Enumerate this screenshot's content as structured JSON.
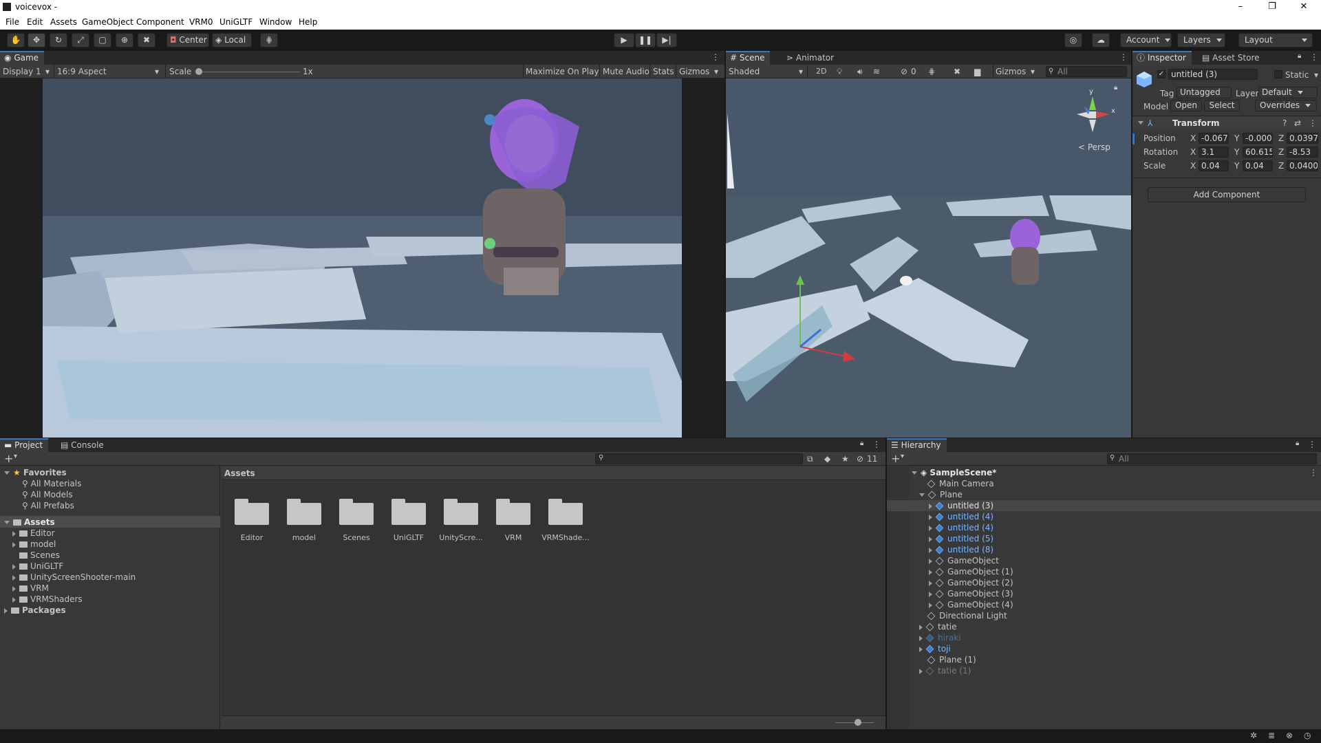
{
  "window": {
    "title": "voicevox -",
    "buttons": [
      "–",
      "❐",
      "✕"
    ]
  },
  "menu": [
    "File",
    "Edit",
    "Assets",
    "GameObject",
    "Component",
    "VRM0",
    "UniGLTF",
    "Window",
    "Help"
  ],
  "toolbar": {
    "pivot": "Center",
    "space": "Local",
    "account": "Account",
    "layers": "Layers",
    "layout": "Layout"
  },
  "game": {
    "tab": "Game",
    "display": "Display 1",
    "aspect": "16:9 Aspect",
    "scale_label": "Scale",
    "scale_value": "1x",
    "maximize": "Maximize On Play",
    "mute": "Mute Audio",
    "stats": "Stats",
    "gizmos": "Gizmos"
  },
  "scene": {
    "tab": "Scene",
    "animator_tab": "Animator",
    "shading": "Shaded",
    "mode2d": "2D",
    "hidden_count": "0",
    "gizmos": "Gizmos",
    "search_placeholder": "All",
    "persp": "< Persp",
    "axis_x": "x",
    "axis_y": "y"
  },
  "inspector": {
    "tab": "Inspector",
    "store_tab": "Asset Store",
    "object_name": "untitled (3)",
    "static": "Static",
    "tag_label": "Tag",
    "tag_value": "Untagged",
    "layer_label": "Layer",
    "layer_value": "Default",
    "model_label": "Model",
    "open": "Open",
    "select": "Select",
    "overrides": "Overrides",
    "transform": "Transform",
    "rows": [
      {
        "label": "Position",
        "x": "-0.067",
        "y": "-0.000",
        "z": "0.0397"
      },
      {
        "label": "Rotation",
        "x": "3.1",
        "y": "60.615",
        "z": "-8.53"
      },
      {
        "label": "Scale",
        "x": "0.04",
        "y": "0.04",
        "z": "0.0400"
      }
    ],
    "add_component": "Add Component"
  },
  "project": {
    "tab": "Project",
    "console_tab": "Console",
    "hidden_count": "11",
    "favorites": "Favorites",
    "fav_items": [
      "All Materials",
      "All Models",
      "All Prefabs"
    ],
    "assets": "Assets",
    "asset_folders": [
      "Editor",
      "model",
      "Scenes",
      "UniGLTF",
      "UnityScreenShooter-main",
      "VRM",
      "VRMShaders"
    ],
    "packages": "Packages",
    "grid_title": "Assets",
    "grid_items": [
      "Editor",
      "model",
      "Scenes",
      "UniGLTF",
      "UnityScre...",
      "VRM",
      "VRMShade..."
    ]
  },
  "hierarchy": {
    "tab": "Hierarchy",
    "search_placeholder": "All",
    "scene": "SampleScene*",
    "rows": [
      {
        "label": "Main Camera",
        "indent": 1,
        "arrow": "",
        "style": "normal"
      },
      {
        "label": "Plane",
        "indent": 1,
        "arrow": "down",
        "style": "normal"
      },
      {
        "label": "untitled (3)",
        "indent": 2,
        "arrow": "right",
        "style": "prefab-sel"
      },
      {
        "label": "untitled (4)",
        "indent": 2,
        "arrow": "right",
        "style": "prefab"
      },
      {
        "label": "untitled (4)",
        "indent": 2,
        "arrow": "right",
        "style": "prefab"
      },
      {
        "label": "untitled (5)",
        "indent": 2,
        "arrow": "right",
        "style": "prefab"
      },
      {
        "label": "untitled (8)",
        "indent": 2,
        "arrow": "right",
        "style": "prefab"
      },
      {
        "label": "GameObject",
        "indent": 2,
        "arrow": "right",
        "style": "normal"
      },
      {
        "label": "GameObject (1)",
        "indent": 2,
        "arrow": "right",
        "style": "normal"
      },
      {
        "label": "GameObject (2)",
        "indent": 2,
        "arrow": "right",
        "style": "normal"
      },
      {
        "label": "GameObject (3)",
        "indent": 2,
        "arrow": "right",
        "style": "normal"
      },
      {
        "label": "GameObject (4)",
        "indent": 2,
        "arrow": "right",
        "style": "normal"
      },
      {
        "label": "Directional Light",
        "indent": 1,
        "arrow": "",
        "style": "normal"
      },
      {
        "label": "tatie",
        "indent": 1,
        "arrow": "right",
        "style": "normal"
      },
      {
        "label": "hiraki",
        "indent": 1,
        "arrow": "right",
        "style": "prefab-dim"
      },
      {
        "label": "toji",
        "indent": 1,
        "arrow": "right",
        "style": "prefab"
      },
      {
        "label": "Plane (1)",
        "indent": 1,
        "arrow": "",
        "style": "normal"
      },
      {
        "label": "tatie (1)",
        "indent": 1,
        "arrow": "right",
        "style": "dim"
      }
    ]
  },
  "colors": {
    "selection": "#2c5d87",
    "prefab_text": "#7cb4ff",
    "accent": "#3a79bb"
  }
}
